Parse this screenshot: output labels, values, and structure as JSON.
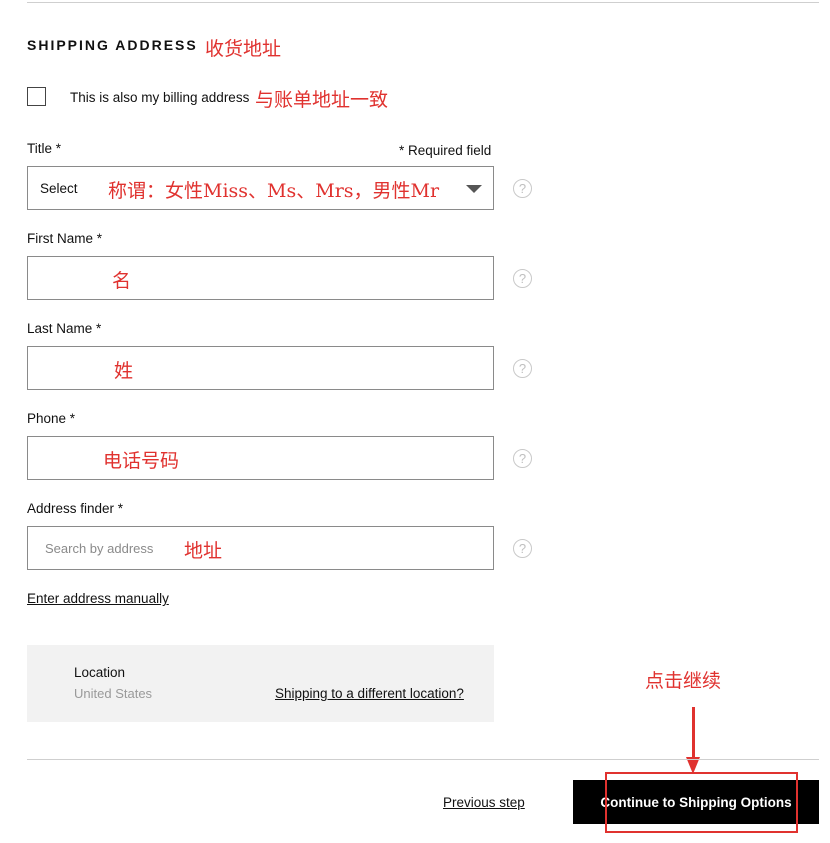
{
  "section": {
    "heading": "SHIPPING ADDRESS",
    "heading_annotation": "收货地址"
  },
  "billing": {
    "label": "This is also my billing address",
    "annotation": "与账单地址一致",
    "checked": false
  },
  "required_note": "* Required field",
  "fields": {
    "title": {
      "label": "Title *",
      "value": "Select",
      "annotation": "称谓：女性Miss、Ms、Mrs，男性Mr"
    },
    "first_name": {
      "label": "First Name *",
      "value": "",
      "annotation": "名"
    },
    "last_name": {
      "label": "Last Name *",
      "value": "",
      "annotation": "姓"
    },
    "phone": {
      "label": "Phone *",
      "value": "",
      "annotation": "电话号码"
    },
    "address_finder": {
      "label": "Address finder *",
      "placeholder": "Search by address",
      "annotation": "地址"
    }
  },
  "help_glyph": "?",
  "enter_manually": "Enter address manually",
  "location": {
    "label": "Location",
    "value": "United States",
    "change_link": "Shipping to a different location?"
  },
  "footer": {
    "previous": "Previous step",
    "continue": "Continue to Shipping Options",
    "continue_annotation": "点击继续"
  },
  "colors": {
    "annotation_red": "#e0322f",
    "button_black": "#000000",
    "location_bg": "#f2f2f2"
  },
  "icons": [
    "checkbox-icon",
    "dropdown-caret-icon",
    "help-circle-icon",
    "arrow-down-icon"
  ]
}
